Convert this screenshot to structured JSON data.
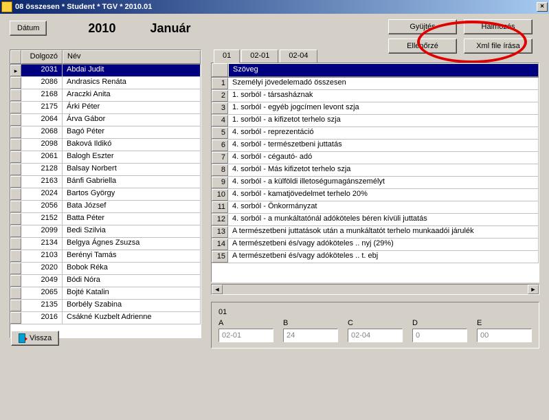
{
  "window": {
    "title": "08 összesen *  Student  * TGV * 2010.01",
    "close_glyph": "×"
  },
  "header": {
    "date_btn": "Dátum",
    "year": "2010",
    "month": "Január"
  },
  "buttons": {
    "collect": "Gyüjtés",
    "accumulate": "Halmozás",
    "check": "Ellenőrzé",
    "xml": "Xml file írása",
    "back": "Vissza"
  },
  "left_grid": {
    "cols": {
      "id": "Dolgozó",
      "name": "Név"
    },
    "rows": [
      {
        "id": "2031",
        "name": "Abdai Judit",
        "selected": true
      },
      {
        "id": "2086",
        "name": "Andrasics Renáta"
      },
      {
        "id": "2168",
        "name": "Araczki Anita"
      },
      {
        "id": "2175",
        "name": "Árki Péter"
      },
      {
        "id": "2064",
        "name": "Árva Gábor"
      },
      {
        "id": "2068",
        "name": "Bagó Péter"
      },
      {
        "id": "2098",
        "name": "Baková Ildikó"
      },
      {
        "id": "2061",
        "name": "Balogh Eszter"
      },
      {
        "id": "2128",
        "name": "Balsay Norbert"
      },
      {
        "id": "2163",
        "name": "Bánfi Gabriella"
      },
      {
        "id": "2024",
        "name": "Bartos György"
      },
      {
        "id": "2056",
        "name": "Bata József"
      },
      {
        "id": "2152",
        "name": "Batta Péter"
      },
      {
        "id": "2099",
        "name": "Bedi Szilvia"
      },
      {
        "id": "2134",
        "name": "Belgya Ágnes Zsuzsa"
      },
      {
        "id": "2103",
        "name": "Berényi Tamás"
      },
      {
        "id": "2020",
        "name": "Bobok Réka"
      },
      {
        "id": "2049",
        "name": "Bódi Nóra"
      },
      {
        "id": "2065",
        "name": "Bojté Katalin"
      },
      {
        "id": "2135",
        "name": "Borbély Szabina"
      },
      {
        "id": "2016",
        "name": "Csákné Kuzbelt Adrienne"
      }
    ]
  },
  "tabs": [
    {
      "label": "01",
      "active": true
    },
    {
      "label": "02-01"
    },
    {
      "label": "02-04"
    }
  ],
  "right_grid": {
    "cols": {
      "num": "",
      "text": "Szöveg"
    },
    "rows": [
      {
        "n": "1",
        "t": "Személyi jövedelemadó összesen"
      },
      {
        "n": "2",
        "t": "1. sorból - társasháznak"
      },
      {
        "n": "3",
        "t": "1. sorból - egyéb jogcímen levont szja"
      },
      {
        "n": "4",
        "t": "1. sorból - a kifizetot terhelo szja"
      },
      {
        "n": "5",
        "t": "4. sorból - reprezentáció"
      },
      {
        "n": "6",
        "t": "4. sorból - természetbeni juttatás"
      },
      {
        "n": "7",
        "t": "4. sorból - cégautó- adó"
      },
      {
        "n": "8",
        "t": "4. sorból - Más  kifizetot terhelo szja"
      },
      {
        "n": "9",
        "t": "4. sorból - a külföldi illetoségumagánszemélyt"
      },
      {
        "n": "10",
        "t": "4. sorból - kamatjövedelmet terhelo 20%"
      },
      {
        "n": "11",
        "t": "4. sorból - Önkormányzat"
      },
      {
        "n": "12",
        "t": "4. sorból - a munkáltatónál adóköteles béren kívüli juttatás"
      },
      {
        "n": "13",
        "t": "A természetbeni juttatások után a munkáltatót terhelo munkaadói járulék"
      },
      {
        "n": "14",
        "t": "A természetbeni és/vagy adóköteles .. nyj (29%)"
      },
      {
        "n": "15",
        "t": "A természetbeni és/vagy adóköteles .. t. ebj"
      }
    ]
  },
  "fields": {
    "group_label": "01",
    "a": {
      "label": "A",
      "value": "02-01"
    },
    "b": {
      "label": "B",
      "value": "24"
    },
    "c": {
      "label": "C",
      "value": "02-04"
    },
    "d": {
      "label": "D",
      "value": "0"
    },
    "e": {
      "label": "E",
      "value": "00"
    }
  }
}
